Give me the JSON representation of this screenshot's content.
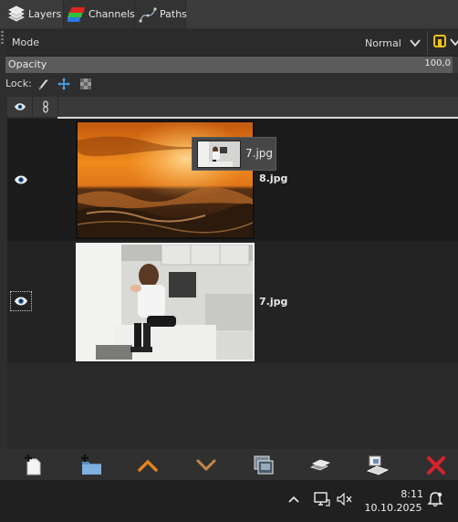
{
  "tabs": [
    {
      "label": "Layers",
      "icon": "layers-icon"
    },
    {
      "label": "Channels",
      "icon": "channels-icon"
    },
    {
      "label": "Paths",
      "icon": "paths-icon"
    }
  ],
  "mode": {
    "label": "Mode",
    "value": "Normal"
  },
  "opacity": {
    "label": "Opacity",
    "value": "100,0",
    "fraction": 1.0
  },
  "lock": {
    "label": "Lock:",
    "icons": [
      "lock-pixels-icon",
      "lock-position-icon",
      "lock-alpha-icon"
    ]
  },
  "list_header": {
    "icons": [
      "visibility-header-icon",
      "chain-header-icon"
    ]
  },
  "layers": [
    {
      "name": "8.jpg",
      "visible": true,
      "selected": false
    },
    {
      "name": "7.jpg",
      "visible": true,
      "selected": true
    }
  ],
  "drag_tooltip": {
    "label": "7.jpg"
  },
  "toolbar": {
    "buttons": [
      "new-layer-icon",
      "new-layer-group-icon",
      "raise-layer-icon",
      "lower-layer-icon",
      "duplicate-layer-icon",
      "anchor-layer-icon",
      "merge-layer-icon",
      "delete-layer-icon"
    ]
  },
  "taskbar": {
    "time": "8:11",
    "date": "10.10.2025",
    "tray_icons": [
      "chevron-up-icon",
      "network-icon",
      "speaker-muted-icon",
      "notifications-icon"
    ]
  },
  "colors": {
    "accent_orange": "#e8821e",
    "delete_red": "#d8222a",
    "panel_bg": "#2e2e2e"
  }
}
